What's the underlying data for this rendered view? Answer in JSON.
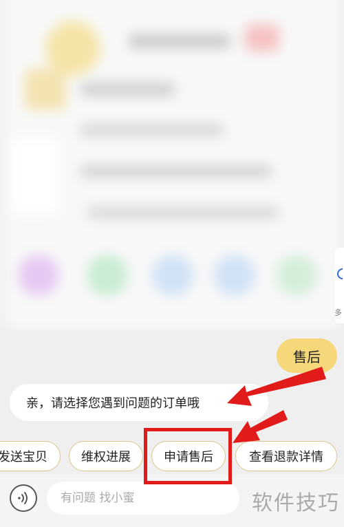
{
  "chat": {
    "user_message": "售后",
    "bot_message": "亲，请选择您遇到问题的订单哦"
  },
  "quick_replies": [
    {
      "label": "发送宝贝"
    },
    {
      "label": "维权进展"
    },
    {
      "label": "申请售后"
    },
    {
      "label": "查看退款详情"
    }
  ],
  "input": {
    "placeholder": "有问题 找小蜜"
  },
  "side_card": {
    "label": "多"
  },
  "watermark": "软件技巧",
  "colors": {
    "background": "#efefef",
    "user_bubble": "#f6d77a",
    "chip_border": "#d9c58c",
    "annotation": "#e11a1a"
  }
}
